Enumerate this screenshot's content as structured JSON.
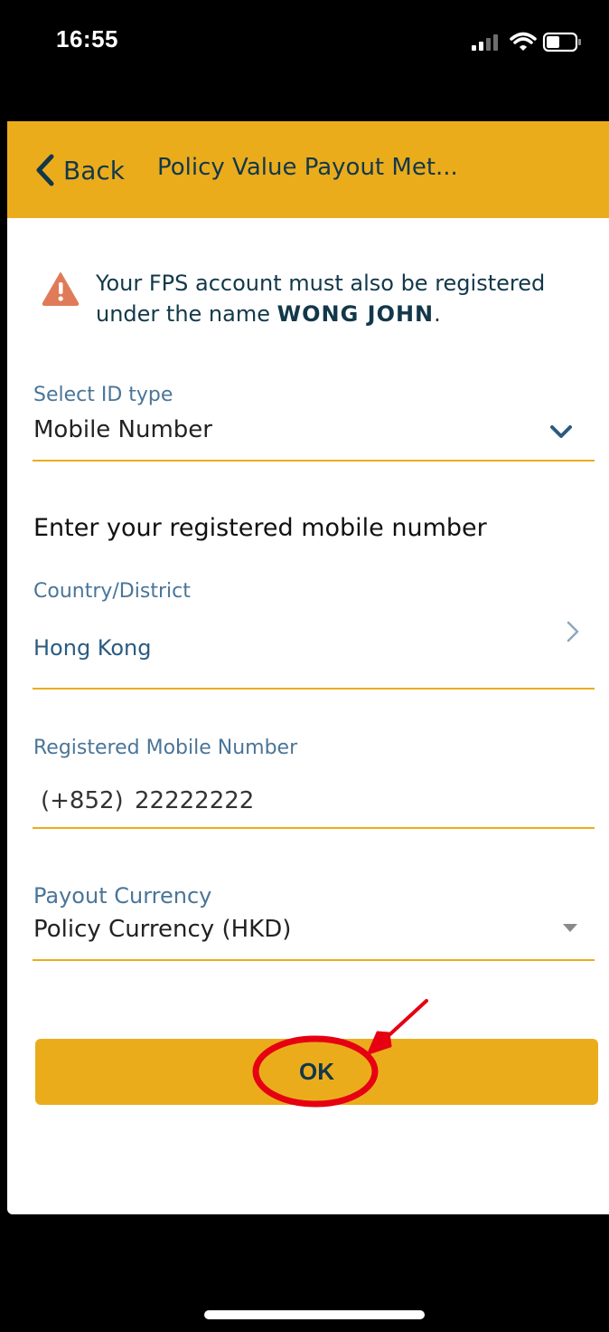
{
  "status_bar": {
    "time": "16:55",
    "icons": [
      "signal-icon",
      "wifi-icon",
      "battery-icon"
    ]
  },
  "header": {
    "back_label": "Back",
    "title": "Policy Value Payout Met..."
  },
  "notice": {
    "icon": "warning-icon",
    "text_before": "Your FPS account must also be registered under the name ",
    "name": "WONG JOHN",
    "text_after": "."
  },
  "id_type": {
    "label": "Select ID type",
    "value": "Mobile Number",
    "icon": "chevron-down-icon"
  },
  "section_heading": "Enter your registered mobile number",
  "country": {
    "label": "Country/District",
    "value": "Hong Kong",
    "icon": "chevron-right-icon"
  },
  "mobile": {
    "label": "Registered Mobile Number",
    "prefix": "(+852)",
    "value": "22222222"
  },
  "currency": {
    "label": "Payout Currency",
    "value": "Policy Currency (HKD)",
    "icon": "caret-down-icon"
  },
  "ok_button": {
    "label": "OK"
  },
  "colors": {
    "accent": "#ebac1c",
    "text_dark": "#12384a",
    "label_blue": "#4a7598",
    "annotation_red": "#e50012",
    "warning": "#e07b5a"
  }
}
